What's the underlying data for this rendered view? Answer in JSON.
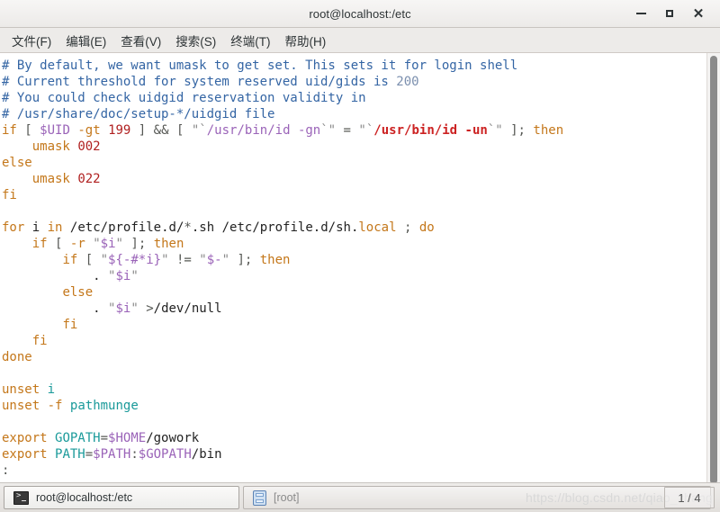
{
  "window": {
    "title": "root@localhost:/etc",
    "controls": {
      "minimize_label": "",
      "maximize_label": "",
      "close_label": "✕"
    }
  },
  "menubar": {
    "items": [
      {
        "label": "文件(F)",
        "name": "menu-file"
      },
      {
        "label": "编辑(E)",
        "name": "menu-edit"
      },
      {
        "label": "查看(V)",
        "name": "menu-view"
      },
      {
        "label": "搜索(S)",
        "name": "menu-search"
      },
      {
        "label": "终端(T)",
        "name": "menu-terminal"
      },
      {
        "label": "帮助(H)",
        "name": "menu-help"
      }
    ]
  },
  "terminal": {
    "prompt": ":",
    "lines": [
      "# By default, we want umask to get set. This sets it for login shell",
      "# Current threshold for system reserved uid/gids is 200",
      "# You could check uidgid reservation validity in",
      "# /usr/share/doc/setup-*/uidgid file",
      "if [ $UID -gt 199 ] && [ \"`/usr/bin/id -gn`\" = \"`/usr/bin/id -un`\" ]; then",
      "    umask 002",
      "else",
      "    umask 022",
      "fi",
      "",
      "for i in /etc/profile.d/*.sh /etc/profile.d/sh.local ; do",
      "    if [ -r \"$i\" ]; then",
      "        if [ \"${-#*i}\" != \"$-\" ]; then",
      "            . \"$i\"",
      "        else",
      "            . \"$i\" >/dev/null",
      "        fi",
      "    fi",
      "done",
      "",
      "unset i",
      "unset -f pathmunge",
      "",
      "export GOPATH=$HOME/gowork",
      "export PATH=$PATH:$GOPATH/bin",
      ":"
    ]
  },
  "taskbar": {
    "items": [
      {
        "label": "root@localhost:/etc",
        "icon": "terminal-icon",
        "active": true
      },
      {
        "label": "[root]",
        "icon": "file-cabinet-icon",
        "active": false
      }
    ],
    "watermark": "https://blog.csdn.net/qiao_zhang",
    "page_indicator": "1 / 4"
  },
  "colors": {
    "comment": "#3465a4",
    "keyword": "#c4771a",
    "variable": "#9a63b8",
    "number": "#b02020",
    "path_highlight": "#cc2222",
    "teal": "#1a9a9a",
    "background": "#ffffff"
  }
}
